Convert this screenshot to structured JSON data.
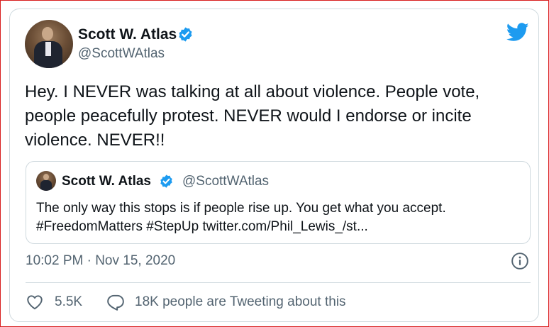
{
  "author": {
    "name": "Scott W. Atlas",
    "handle": "@ScottWAtlas"
  },
  "tweet": {
    "text": "Hey. I NEVER was talking at all about violence. People vote, people peacefully protest. NEVER would I endorse or incite violence. NEVER!!",
    "timestamp": "10:02 PM · Nov 15, 2020"
  },
  "quoted_tweet": {
    "name": "Scott W. Atlas",
    "handle": "@ScottWAtlas",
    "line1": "The only way this stops is if people rise up. You get what you accept.",
    "line2": "#FreedomMatters #StepUp twitter.com/Phil_Lewis_/st..."
  },
  "engagement": {
    "likes": "5.5K",
    "conversation": "18K people are Tweeting about this"
  },
  "icons": {
    "verified": "verified-badge-icon",
    "brand": "twitter-bird-icon",
    "info": "info-icon",
    "like": "heart-icon",
    "reply": "speech-bubble-icon"
  },
  "colors": {
    "brand_blue": "#1d9bf0",
    "text_primary": "#0f1419",
    "text_secondary": "#536471",
    "border": "#cfd9de",
    "frame": "#d81e1e"
  }
}
